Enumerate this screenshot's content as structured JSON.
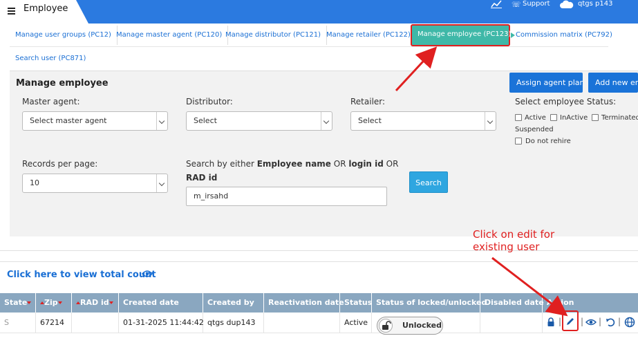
{
  "header": {
    "app_title": "Employee",
    "support_label": "Support",
    "user_label": "qtgs     p143"
  },
  "tabs": [
    {
      "label": "Manage user groups (PC12)"
    },
    {
      "label": "Manage master agent (PC120)"
    },
    {
      "label": "Manage distributor (PC121)"
    },
    {
      "label": "Manage retailer (PC122)"
    },
    {
      "label": "Manage employee (PC123)",
      "active": true
    },
    {
      "label": "Commission matrix (PC792)"
    },
    {
      "label": "Search user (PC871)"
    }
  ],
  "panel": {
    "title": "Manage employee",
    "assign_btn": "Assign agent plan",
    "add_btn": "Add new em",
    "master_agent_label": "Master agent:",
    "master_agent_value": "Select master agent",
    "distributor_label": "Distributor:",
    "distributor_value": "Select",
    "retailer_label": "Retailer:",
    "retailer_value": "Select",
    "status_label": "Select employee Status:",
    "status_options": [
      "Active",
      "InActive",
      "Terminated",
      "Suspended",
      "Do not rehire"
    ],
    "records_label": "Records per page:",
    "records_value": "10",
    "search_label_1": "Search by either ",
    "search_bold_1": "Employee name",
    "search_label_2": " OR ",
    "search_bold_2": "login id",
    "search_label_3": " OR",
    "search_bold_3": "RAD id",
    "search_value": "m_irsahd",
    "search_btn": "Search"
  },
  "total_count_link": "Click here to view total count",
  "table": {
    "headers": [
      "State",
      "Zip",
      "RAD id",
      "Created date",
      "Created by",
      "Reactivation date",
      "Status",
      "Status of locked/unlocked",
      "Disabled date",
      "Action"
    ],
    "row": {
      "state": "S",
      "zip": "67214",
      "rad": "",
      "created_date": "01-31-2025 11:44:42",
      "created_by": "qtgs     dup143",
      "reactivation": "",
      "status": "Active",
      "lock": "Unlocked",
      "disabled": ""
    }
  },
  "annotations": {
    "callout_line1": "Click on edit for",
    "callout_line2": "existing user"
  },
  "colors": {
    "topbar": "#2b7ae0",
    "active_tab": "#3fb8a8",
    "highlight": "#e02020",
    "table_header": "#8aa7c0"
  }
}
